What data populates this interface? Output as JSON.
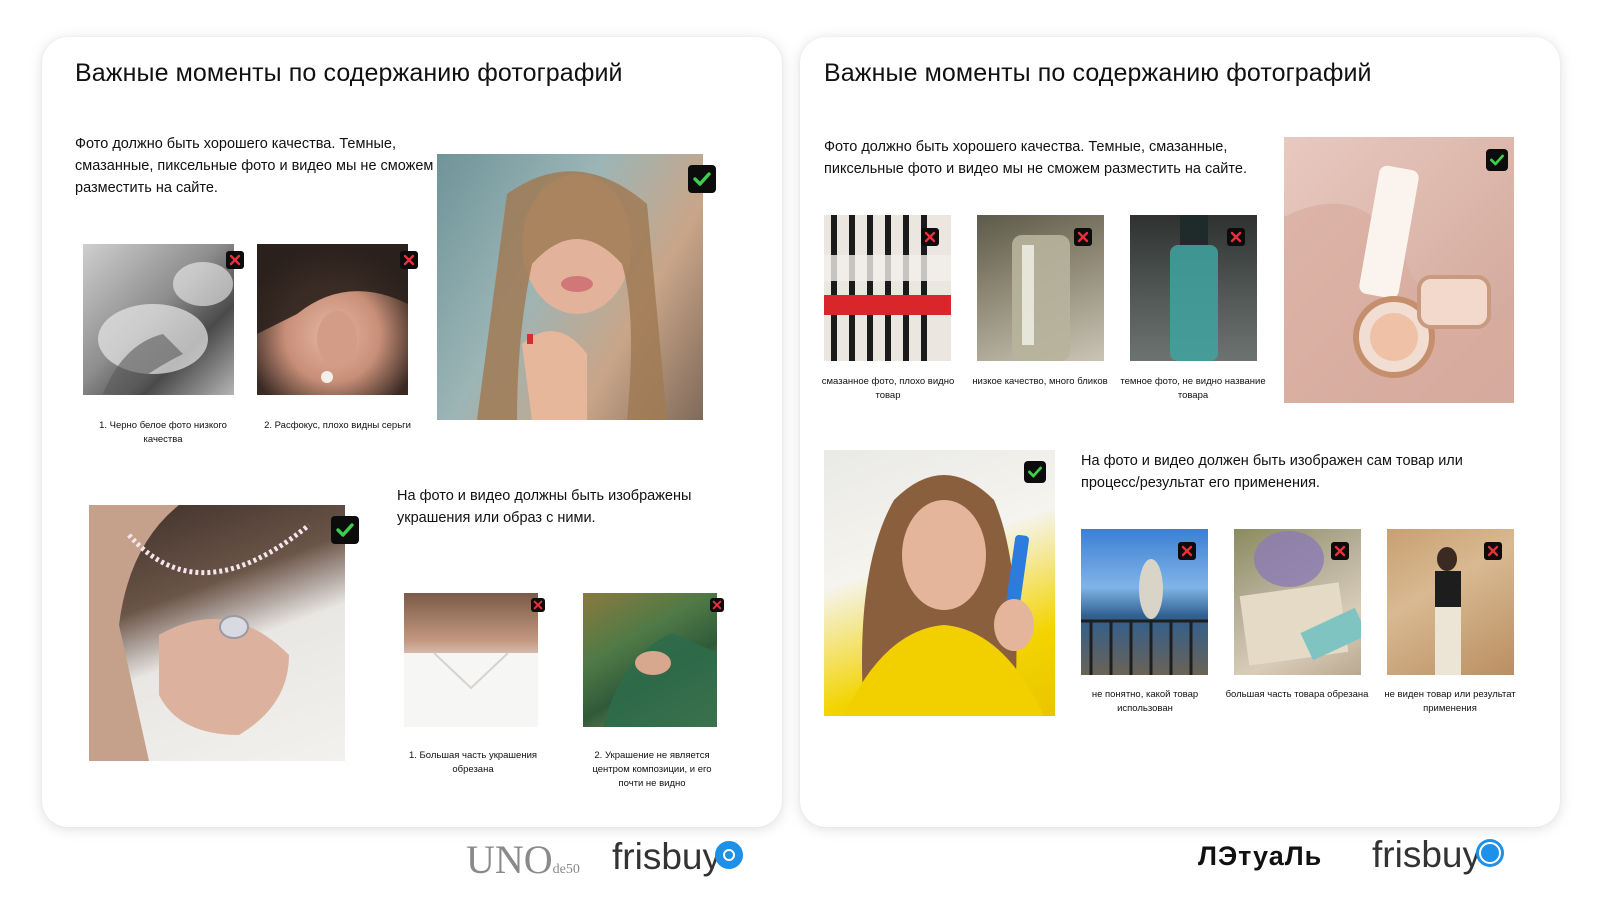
{
  "left_panel": {
    "title": "Важные моменты по содержанию фотографий",
    "intro_text": "Фото должно быть хорошего качества. Темные, смазанные, пиксельные фото и видео мы не сможем разместить на сайте.",
    "section2_text": "На фото и видео должны быть изображены украшения или образ с ними.",
    "bad_examples_top": [
      {
        "caption": "1. Черно белое фото низкого качества"
      },
      {
        "caption": "2. Расфокус, плохо видны серьги"
      }
    ],
    "bad_examples_bottom": [
      {
        "caption": "1. Большая часть украшения обрезана"
      },
      {
        "caption": "2. Украшение не является центром композиции, и его почти не видно"
      }
    ]
  },
  "right_panel": {
    "title": "Важные моменты по содержанию фотографий",
    "intro_text": "Фото должно быть хорошего качества. Темные, смазанные, пиксельные фото и видео мы не сможем разместить на сайте.",
    "section2_text": "На фото и видео должен быть изображен сам товар или процесс/результат его применения.",
    "bad_examples_top": [
      {
        "caption": "смазанное фото, плохо видно товар"
      },
      {
        "caption": "низкое качество, много бликов"
      },
      {
        "caption": "темное фото, не видно название товара"
      }
    ],
    "bad_examples_bottom": [
      {
        "caption": "не понятно, какой товар использован"
      },
      {
        "caption": "большая часть товара обрезана"
      },
      {
        "caption": "не виден товар или результат применения"
      }
    ]
  },
  "logos": {
    "uno": "UNO",
    "uno_sub": "de50",
    "frisbuy": "frisbuy",
    "letual": "ЛЭтуаЛь"
  },
  "colors": {
    "ok_check": "#3ecf4a",
    "bad_cross": "#e8303a",
    "frisbuy_dot": "#1e90e8",
    "logo_gray": "#8a8a8a"
  },
  "icons": {
    "good": "check-icon",
    "bad": "cross-icon"
  }
}
